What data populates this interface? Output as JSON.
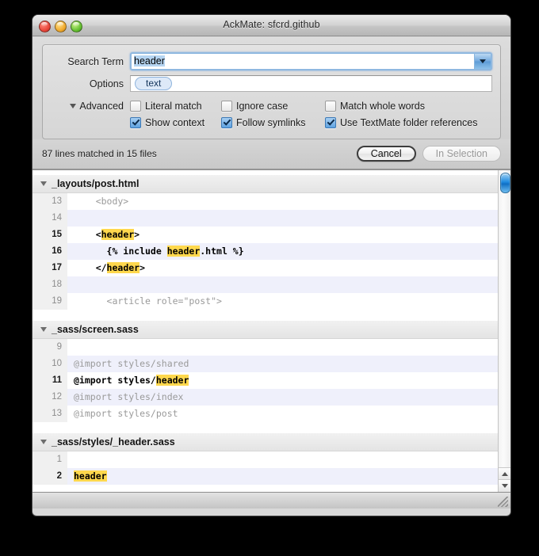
{
  "window": {
    "title": "AckMate: sfcrd.github",
    "traffic_lights": [
      "close-button",
      "minimize-button",
      "zoom-button"
    ]
  },
  "search": {
    "term_label": "Search Term",
    "term_value": "header",
    "dropdown_icon": "chevron-down-icon",
    "options_label": "Options",
    "option_tokens": [
      "text"
    ]
  },
  "advanced": {
    "toggle_label": "Advanced",
    "disclosure_icon": "triangle-down-icon",
    "checkboxes": [
      {
        "label": "Literal match",
        "checked": false
      },
      {
        "label": "Ignore case",
        "checked": false
      },
      {
        "label": "Match whole words",
        "checked": false
      },
      {
        "label": "Show context",
        "checked": true
      },
      {
        "label": "Follow symlinks",
        "checked": true
      },
      {
        "label": "Use TextMate folder references",
        "checked": true
      }
    ]
  },
  "status": {
    "text": "87 lines matched in 15 files",
    "cancel_label": "Cancel",
    "in_selection_label": "In Selection"
  },
  "results": {
    "groups": [
      {
        "file": "_layouts/post.html",
        "rows": [
          {
            "num": "13",
            "pre": "    <body>",
            "match": "",
            "post": "",
            "is_match": false
          },
          {
            "num": "14",
            "pre": "",
            "match": "",
            "post": "",
            "is_match": false
          },
          {
            "num": "15",
            "pre": "    <",
            "match": "header",
            "post": ">",
            "is_match": true
          },
          {
            "num": "16",
            "pre": "      {% include ",
            "match": "header",
            "post": ".html %}",
            "is_match": true
          },
          {
            "num": "17",
            "pre": "    </",
            "match": "header",
            "post": ">",
            "is_match": true
          },
          {
            "num": "18",
            "pre": "",
            "match": "",
            "post": "",
            "is_match": false
          },
          {
            "num": "19",
            "pre": "      <article role=\"post\">",
            "match": "",
            "post": "",
            "is_match": false
          }
        ]
      },
      {
        "file": "_sass/screen.sass",
        "rows": [
          {
            "num": "9",
            "pre": "",
            "match": "",
            "post": "",
            "is_match": false
          },
          {
            "num": "10",
            "pre": "@import styles/shared",
            "match": "",
            "post": "",
            "is_match": false
          },
          {
            "num": "11",
            "pre": "@import styles/",
            "match": "header",
            "post": "",
            "is_match": true
          },
          {
            "num": "12",
            "pre": "@import styles/index",
            "match": "",
            "post": "",
            "is_match": false
          },
          {
            "num": "13",
            "pre": "@import styles/post",
            "match": "",
            "post": "",
            "is_match": false
          }
        ]
      },
      {
        "file": "_sass/styles/_header.sass",
        "rows": [
          {
            "num": "1",
            "pre": "",
            "match": "",
            "post": "",
            "is_match": false
          },
          {
            "num": "2",
            "pre": "",
            "match": "header",
            "post": "",
            "is_match": true
          }
        ]
      }
    ]
  },
  "scrollbar": {
    "up_arrow_icon": "triangle-up-icon",
    "down_arrow_icon": "triangle-down-icon",
    "thumb_color": "#1f8ae0"
  },
  "colors": {
    "match_highlight": "#ffd84d",
    "selection": "#b5d4f1",
    "accent": "#5ea2e0"
  }
}
